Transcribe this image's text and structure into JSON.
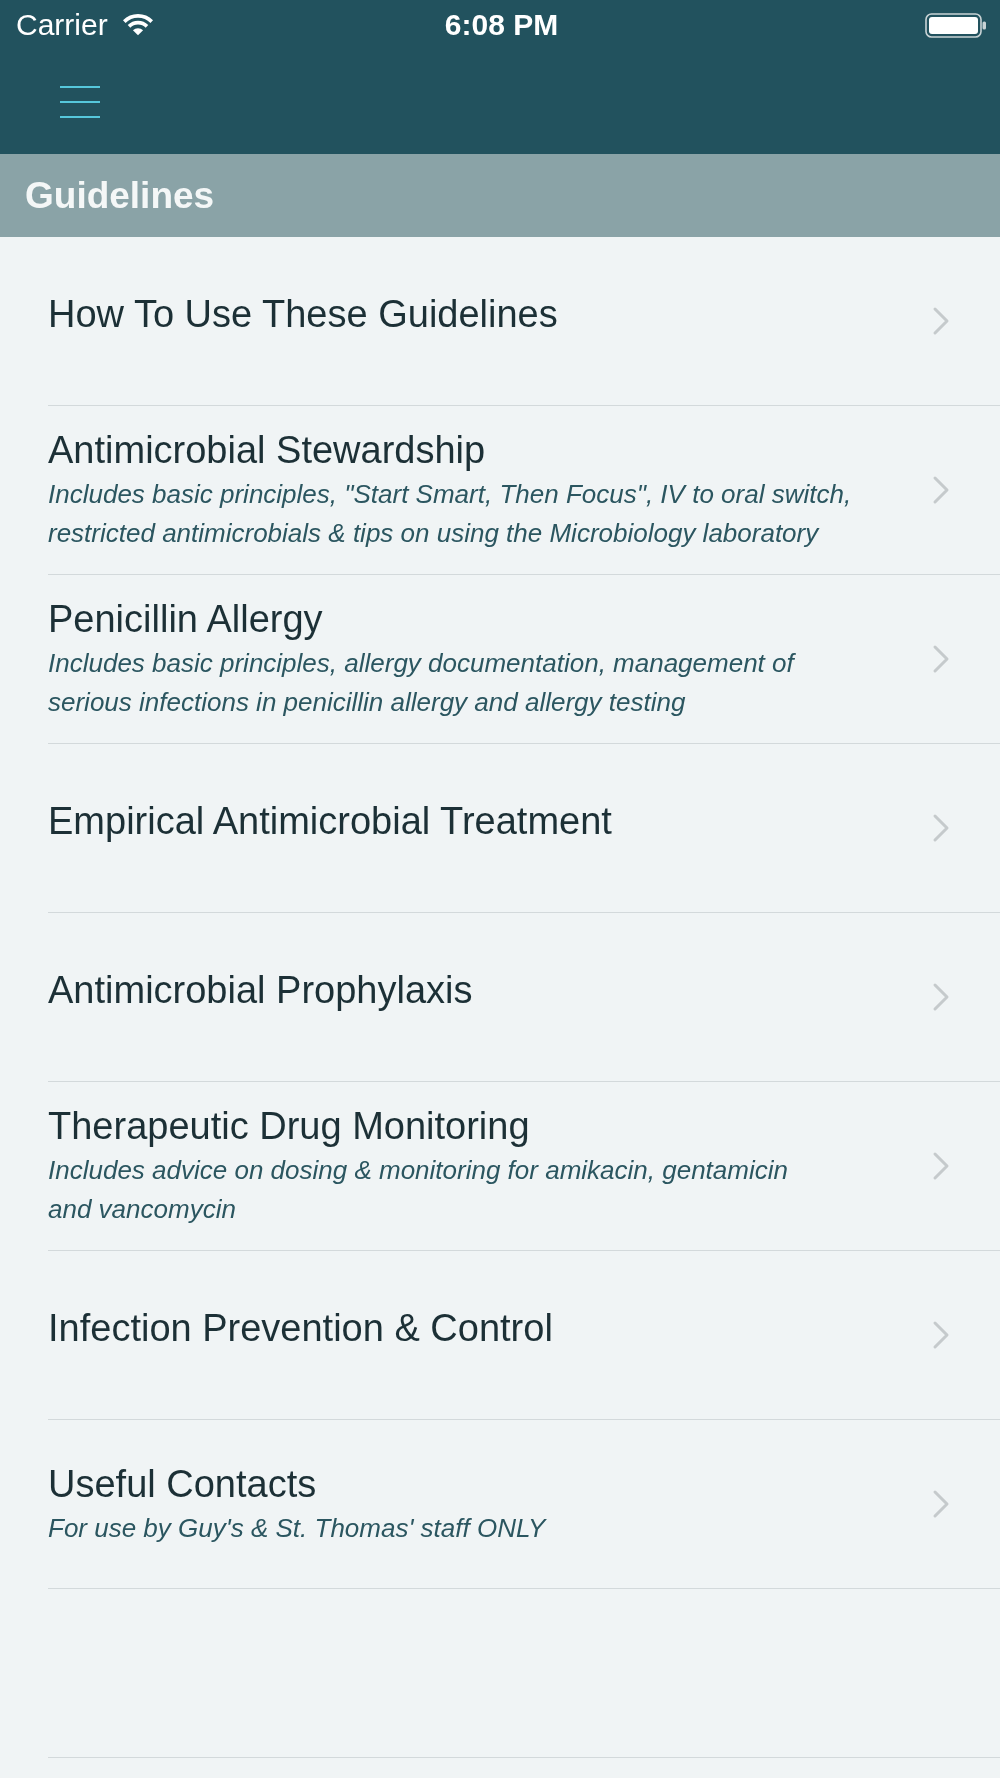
{
  "status_bar": {
    "carrier": "Carrier",
    "time": "6:08 PM"
  },
  "section_header": {
    "title": "Guidelines"
  },
  "items": [
    {
      "title": "How To Use These Guidelines"
    },
    {
      "title": "Antimicrobial Stewardship",
      "subtitle": "Includes basic principles, \"Start Smart, Then Focus\", IV to oral switch,\nrestricted antimicrobials & tips on using the Microbiology laboratory"
    },
    {
      "title": "Penicillin Allergy",
      "subtitle": "Includes basic principles, allergy documentation, management of\nserious infections in penicillin allergy and allergy testing"
    },
    {
      "title": "Empirical Antimicrobial Treatment"
    },
    {
      "title": "Antimicrobial Prophylaxis"
    },
    {
      "title": "Therapeutic Drug Monitoring",
      "subtitle": "Includes advice on dosing & monitoring for amikacin, gentamicin\nand vancomycin"
    },
    {
      "title": "Infection Prevention & Control"
    },
    {
      "title": "Useful Contacts",
      "subtitle": "For use by Guy's & St. Thomas' staff ONLY"
    }
  ]
}
